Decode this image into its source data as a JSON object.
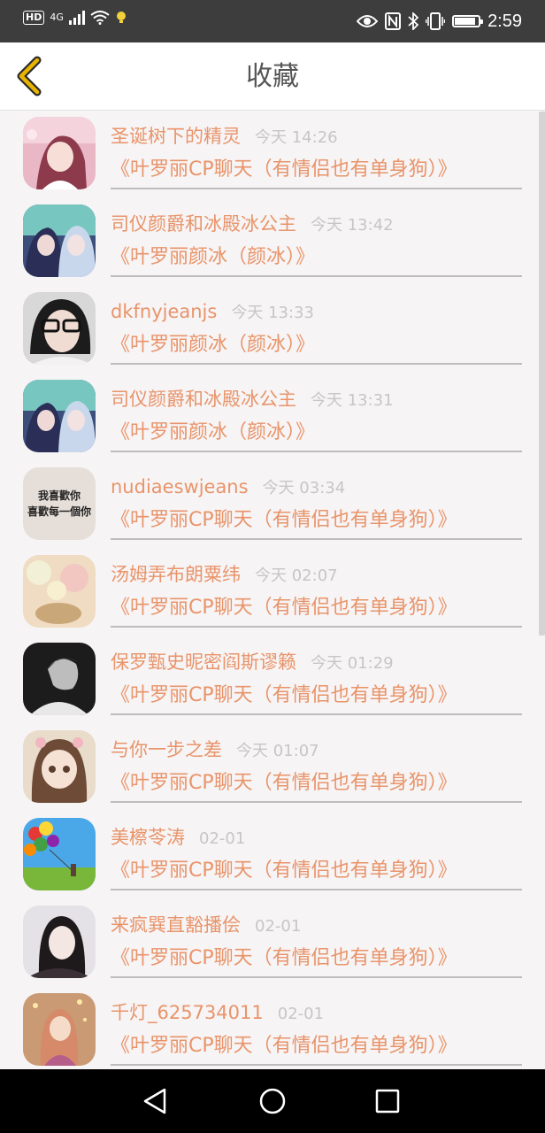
{
  "status_bar": {
    "network_label": "HD",
    "signal_label": "4G",
    "time": "2:59",
    "battery_level": 0.9,
    "icons": [
      "hd-icon",
      "signal-icon",
      "wifi-icon",
      "notification-icon",
      "eye-icon",
      "nfc-icon",
      "bluetooth-icon",
      "vibrate-icon",
      "battery-icon"
    ]
  },
  "header": {
    "title": "收藏",
    "back_icon": "chevron-left-icon",
    "accent_color": "#e8b400"
  },
  "colors": {
    "accent": "#e8946a",
    "muted": "#c6c6c6",
    "background": "#f7f4f5"
  },
  "items": [
    {
      "name": "圣诞树下的精灵",
      "time": "今天 14:26",
      "topic": "《叶罗丽CP聊天（有情侣也有单身狗）》"
    },
    {
      "name": "司仪颜爵和冰殿冰公主",
      "time": "今天 13:42",
      "topic": "《叶罗丽颜冰（颜冰）》"
    },
    {
      "name": "dkfnyjeanjs",
      "time": "今天 13:33",
      "topic": "《叶罗丽颜冰（颜冰）》"
    },
    {
      "name": "司仪颜爵和冰殿冰公主",
      "time": "今天 13:31",
      "topic": "《叶罗丽颜冰（颜冰）》"
    },
    {
      "name": "nudiaeswjeans",
      "time": "今天 03:34",
      "topic": "《叶罗丽CP聊天（有情侣也有单身狗）》",
      "avatar_text": [
        "我喜歡你",
        "喜歡每一個你"
      ]
    },
    {
      "name": "汤姆弄布朗粟纬",
      "time": "今天 02:07",
      "topic": "《叶罗丽CP聊天（有情侣也有单身狗）》"
    },
    {
      "name": "保罗甄史昵密阎斯谬籁",
      "time": "今天 01:29",
      "topic": "《叶罗丽CP聊天（有情侣也有单身狗）》"
    },
    {
      "name": "与你一步之差",
      "time": "今天 01:07",
      "topic": "《叶罗丽CP聊天（有情侣也有单身狗）》"
    },
    {
      "name": "美檫苓涛",
      "time": "02-01",
      "topic": "《叶罗丽CP聊天（有情侣也有单身狗）》"
    },
    {
      "name": "来疯巽直豁播侩",
      "time": "02-01",
      "topic": "《叶罗丽CP聊天（有情侣也有单身狗）》"
    },
    {
      "name": "千灯_625734011",
      "time": "02-01",
      "topic": "《叶罗丽CP聊天（有情侣也有单身狗）》"
    }
  ],
  "nav_bar": {
    "icons": [
      "back-triangle-icon",
      "home-circle-icon",
      "recents-square-icon"
    ]
  }
}
